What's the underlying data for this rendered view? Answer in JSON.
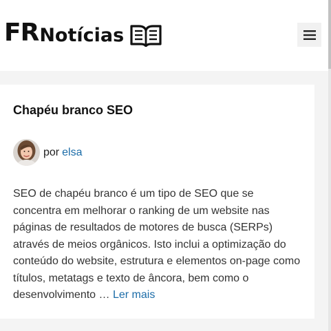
{
  "site": {
    "logo_prefix": "FR",
    "logo_suffix": "Notícias"
  },
  "post": {
    "title": "Chapéu branco SEO",
    "by_label": "por",
    "author": "elsa",
    "excerpt": "SEO de chapéu branco é um tipo de SEO que se concentra em melhorar o ranking de um website nas páginas de resultados de motores de busca (SERPs) através de meios orgânicos. Isto inclui a optimização do conteúdo do website, estrutura e elementos on-page como títulos, metatags e texto de âncora, bem como o desenvolvimento",
    "ellipsis": "…",
    "read_more": "Ler mais"
  },
  "icons": {
    "logo": "open-book-icon",
    "menu": "hamburger-menu-icon"
  },
  "colors": {
    "link": "#1b6ca8",
    "text": "#333333",
    "title": "#111111",
    "background": "#f4f4f4",
    "card": "#ffffff"
  }
}
